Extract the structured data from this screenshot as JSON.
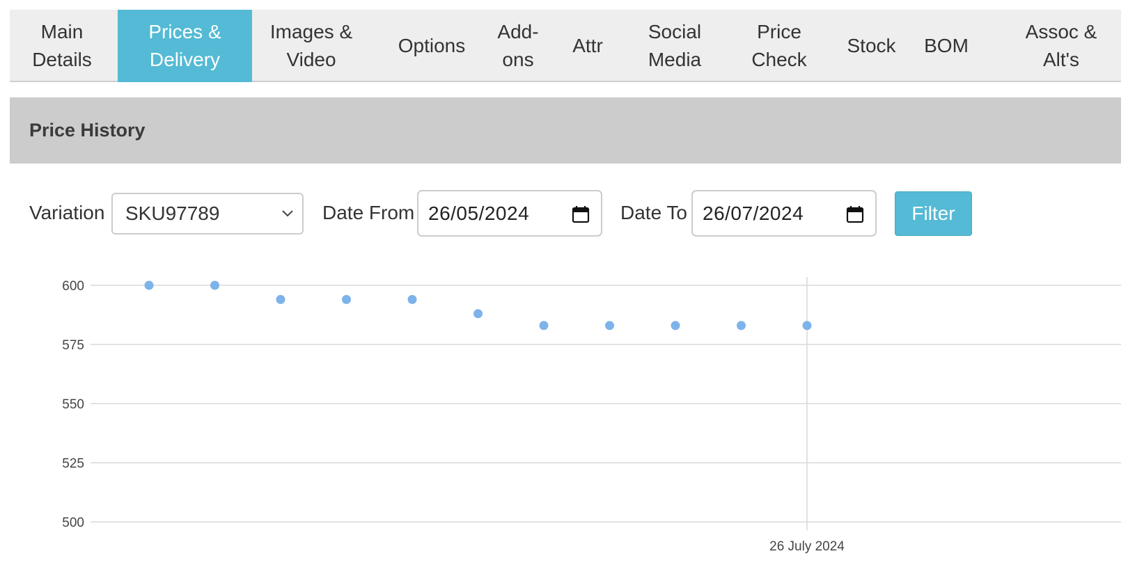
{
  "tabs": [
    {
      "label": "Main\nDetails",
      "active": false
    },
    {
      "label": "Prices &\nDelivery",
      "active": true
    },
    {
      "label": "Images &\nVideo",
      "active": false
    },
    {
      "label": "Options",
      "active": false
    },
    {
      "label": "Add-\nons",
      "active": false
    },
    {
      "label": "Attr",
      "active": false
    },
    {
      "label": "Social\nMedia",
      "active": false
    },
    {
      "label": "Price\nCheck",
      "active": false
    },
    {
      "label": "Stock",
      "active": false
    },
    {
      "label": "BOM",
      "active": false
    },
    {
      "label": "Assoc &\nAlt's",
      "active": false
    }
  ],
  "section": {
    "title": "Price History"
  },
  "filters": {
    "variation_label": "Variation",
    "variation_value": "SKU97789",
    "date_from_label": "Date From",
    "date_from_value": "26/05/2024",
    "date_to_label": "Date To",
    "date_to_value": "26/07/2024",
    "filter_button": "Filter"
  },
  "colors": {
    "accent": "#54bad5",
    "point": "#7db3ea",
    "grid": "#d9d9d9"
  },
  "chart_data": {
    "type": "scatter",
    "ylim": [
      500,
      600
    ],
    "yticks": [
      600,
      575,
      550,
      525,
      500
    ],
    "xtick_labels": [
      "26 July 2024"
    ],
    "series": [
      {
        "x": [
          "2024-07-16",
          "2024-07-17",
          "2024-07-18",
          "2024-07-19",
          "2024-07-20",
          "2024-07-21",
          "2024-07-22",
          "2024-07-23",
          "2024-07-24",
          "2024-07-25",
          "2024-07-26"
        ],
        "values": [
          600,
          600,
          594,
          594,
          594,
          588,
          583,
          583,
          583,
          583,
          583
        ]
      }
    ],
    "grid": true
  }
}
